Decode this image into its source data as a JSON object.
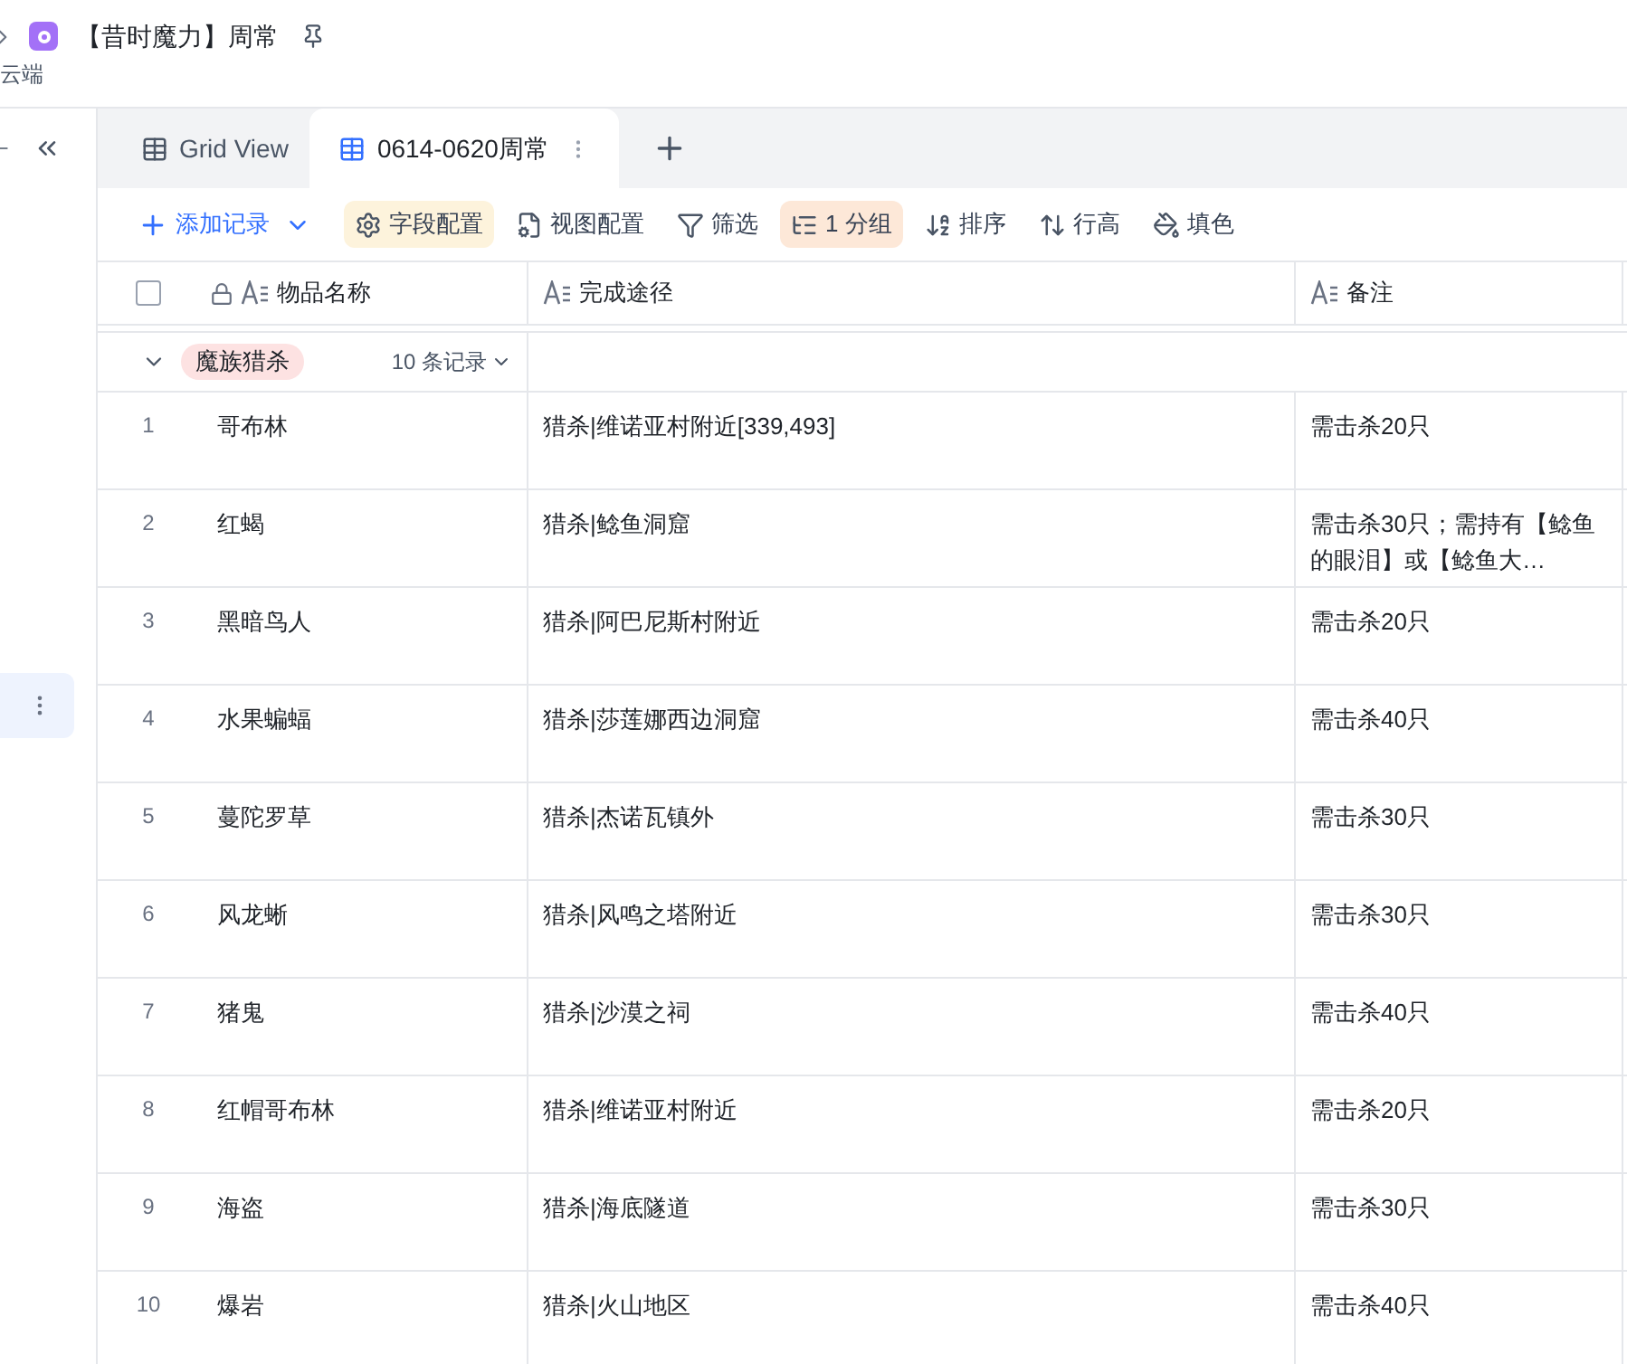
{
  "document": {
    "title": "【昔时魔力】周常",
    "subtitle": "云端"
  },
  "tabs": [
    {
      "label": "Grid View",
      "selected": false
    },
    {
      "label": "0614-0620周常",
      "selected": true
    }
  ],
  "toolbar": [
    {
      "label": "添加记录",
      "kind": "primary",
      "active": false
    },
    {
      "label": "字段配置",
      "kind": "plain",
      "active": true,
      "color": "#fdf3dc"
    },
    {
      "label": "视图配置",
      "kind": "plain",
      "active": false
    },
    {
      "label": "筛选",
      "kind": "plain",
      "active": false
    },
    {
      "label": "1 分组",
      "kind": "plain",
      "active": true,
      "color": "#fde8d8"
    },
    {
      "label": "排序",
      "kind": "plain",
      "active": false
    },
    {
      "label": "行高",
      "kind": "plain",
      "active": false
    },
    {
      "label": "填色",
      "kind": "plain",
      "active": false
    }
  ],
  "table": {
    "select_all": {
      "checked": false
    },
    "columns": [
      {
        "label": "物品名称",
        "locked": true
      },
      {
        "label": "完成途径",
        "locked": false
      },
      {
        "label": "备注",
        "locked": false
      }
    ],
    "group": {
      "tag": "魔族猎杀",
      "count": "10 条记录",
      "expanded": true
    },
    "rows": [
      {
        "index": "1",
        "name": "哥布林",
        "path": "猎杀|维诺亚村附近[339,493]",
        "note": "需击杀20只"
      },
      {
        "index": "2",
        "name": "红蝎",
        "path": "猎杀|鲶鱼洞窟",
        "note": "需击杀30只；需持有【鲶鱼的眼泪】或【鲶鱼大…"
      },
      {
        "index": "3",
        "name": "黑暗鸟人",
        "path": "猎杀|阿巴尼斯村附近",
        "note": "需击杀20只"
      },
      {
        "index": "4",
        "name": "水果蝙蝠",
        "path": "猎杀|莎莲娜西边洞窟",
        "note": "需击杀40只"
      },
      {
        "index": "5",
        "name": "蔓陀罗草",
        "path": "猎杀|杰诺瓦镇外",
        "note": "需击杀30只"
      },
      {
        "index": "6",
        "name": "风龙蜥",
        "path": "猎杀|风鸣之塔附近",
        "note": "需击杀30只"
      },
      {
        "index": "7",
        "name": "猪鬼",
        "path": "猎杀|沙漠之祠",
        "note": "需击杀40只"
      },
      {
        "index": "8",
        "name": "红帽哥布林",
        "path": "猎杀|维诺亚村附近",
        "note": "需击杀20只"
      },
      {
        "index": "9",
        "name": "海盗",
        "path": "猎杀|海底隧道",
        "note": "需击杀30只"
      },
      {
        "index": "10",
        "name": "爆岩",
        "path": "猎杀|火山地区",
        "note": "需击杀40只"
      }
    ]
  }
}
